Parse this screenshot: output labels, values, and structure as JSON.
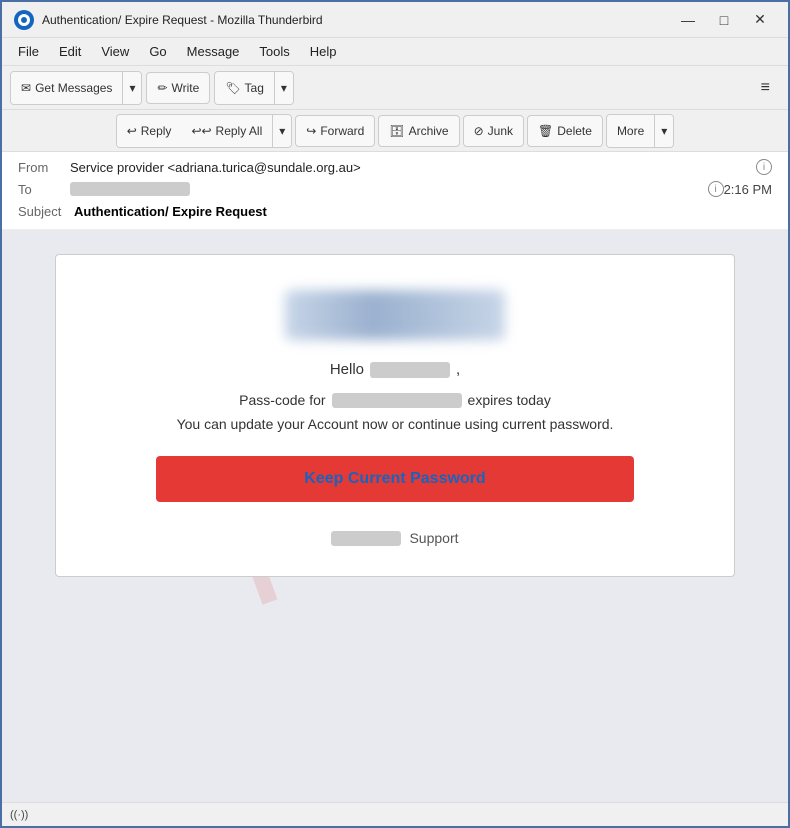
{
  "window": {
    "title": "Authentication/ Expire Request - Mozilla Thunderbird",
    "controls": {
      "minimize": "—",
      "maximize": "□",
      "close": "✕"
    }
  },
  "menubar": {
    "items": [
      "File",
      "Edit",
      "View",
      "Go",
      "Message",
      "Tools",
      "Help"
    ]
  },
  "toolbar": {
    "get_messages_label": "Get Messages",
    "write_label": "Write",
    "tag_label": "Tag",
    "hamburger": "≡"
  },
  "action_toolbar": {
    "reply_label": "Reply",
    "reply_all_label": "Reply All",
    "forward_label": "Forward",
    "archive_label": "Archive",
    "junk_label": "Junk",
    "delete_label": "Delete",
    "more_label": "More"
  },
  "email": {
    "from_label": "From",
    "from_value": "Service provider <adriana.turica@sundale.org.au>",
    "to_label": "To",
    "time": "2:16 PM",
    "subject_label": "Subject",
    "subject_value": "Authentication/ Expire Request"
  },
  "email_body": {
    "greeting": "Hello",
    "passcode_text_before": "Pass-code for",
    "passcode_text_after": "expires today",
    "update_text": "You can update your Account now or continue using current password.",
    "button_label": "Keep Current Password",
    "footer_support": "Support"
  },
  "status_bar": {
    "icon": "((·))",
    "text": ""
  }
}
